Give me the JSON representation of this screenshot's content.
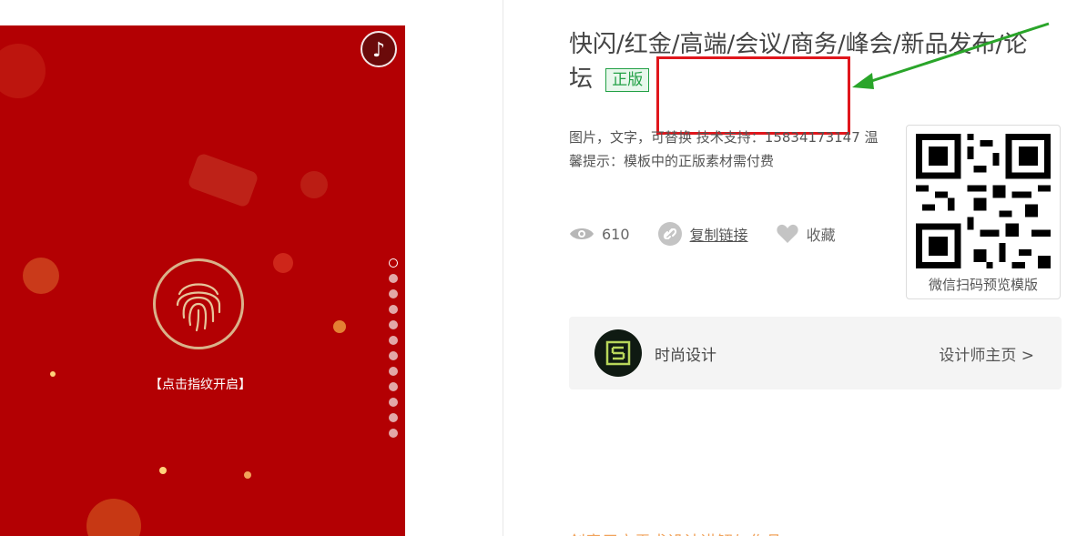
{
  "preview": {
    "music_icon": "music-note-icon",
    "fingerprint_icon": "fingerprint-icon",
    "open_hint": "【点击指纹开启】",
    "page_dots": 12,
    "active_dot": 0,
    "background_color": "#b30003"
  },
  "template": {
    "title": "快闪/红金/高端/会议/商务/峰会/新品发布/论坛",
    "badge": "正版",
    "description": "图片，文字，可替换 技术支持：15834173147 温馨提示：模板中的正版素材需付费"
  },
  "stats": {
    "views_icon": "eye-icon",
    "views": "610",
    "copy_icon": "link-icon",
    "copy_link": "复制链接",
    "favorite_icon": "heart-icon",
    "favorite": "收藏"
  },
  "qr": {
    "caption": "微信扫码预览模版"
  },
  "designer": {
    "name": "时尚设计",
    "homepage_link": "设计师主页 >"
  },
  "footer": {
    "partial_text": "创意用户需求设计讲解与作品"
  },
  "colors": {
    "badge_green": "#22a045",
    "highlight_red": "#e0161c",
    "arrow_green": "#2aa52a"
  }
}
